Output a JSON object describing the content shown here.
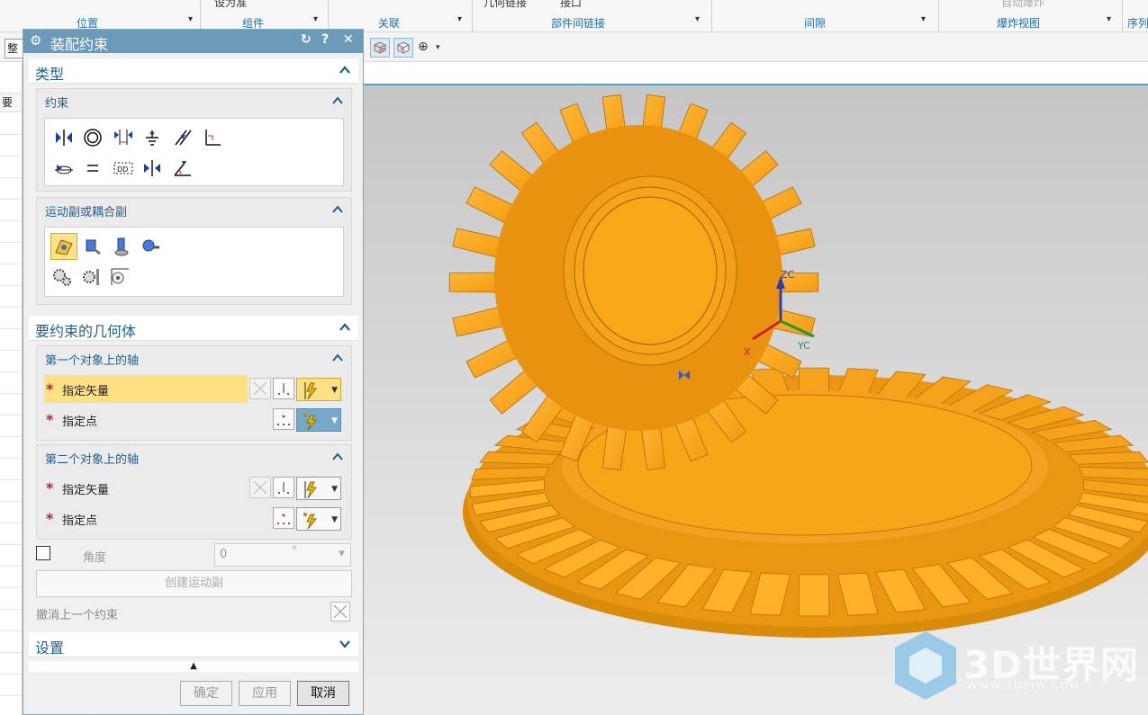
{
  "ribbon": {
    "top_snippets": [
      "设为准",
      "几何链接",
      "接口",
      "自动爆炸"
    ],
    "groups": [
      "位置",
      "组件",
      "关联",
      "部件间链接",
      "间隙",
      "爆炸视图",
      "序列"
    ]
  },
  "toolbar": {
    "combo_text": "整"
  },
  "left_strip": {
    "header": "要"
  },
  "dialog": {
    "title": "装配约束",
    "type_section": {
      "title": "类型",
      "constraints_title": "约束",
      "motion_title": "运动副或耦合副"
    },
    "geometry_section": {
      "title": "要约束的几何体",
      "first_axis": {
        "title": "第一个对象上的轴",
        "vector_label": "指定矢量",
        "point_label": "指定点"
      },
      "second_axis": {
        "title": "第二个对象上的轴",
        "vector_label": "指定矢量",
        "point_label": "指定点"
      },
      "angle_label": "角度",
      "angle_value": "0",
      "angle_unit": "°",
      "create_button": "创建运动副",
      "undo_label": "撤消上一个约束"
    },
    "settings_title": "设置",
    "buttons": {
      "ok": "确定",
      "apply": "应用",
      "cancel": "取消"
    }
  },
  "viewport": {
    "axis_labels": {
      "z": "ZC",
      "y": "YC",
      "x": "X"
    }
  },
  "watermark": {
    "brand": "3D世界网",
    "url": "WWW.3DSJW.COM"
  },
  "colors": {
    "accent": "#1f5f8b",
    "title_bar": "#6c9ab8",
    "gear_face": "#f7a21b",
    "gear_shadow": "#c97a07",
    "highlight": "#ffe082"
  }
}
